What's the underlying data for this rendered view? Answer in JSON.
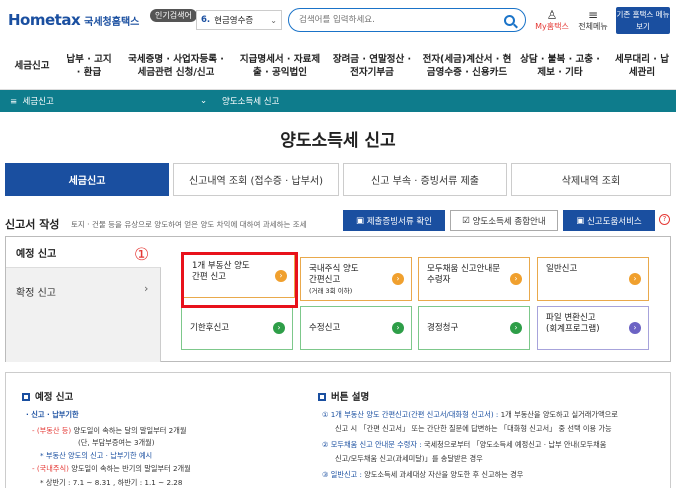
{
  "header": {
    "logo_text": "Hometax",
    "logo_sub": "국세청홈택스",
    "popular_badge": "인기검색어",
    "popular_num": "6.",
    "popular_term": "현금영수증",
    "search_placeholder": "검색어를 입력하세요.",
    "my_hometax": "My홈택스",
    "all_menu": "전체메뉴",
    "old_home": "기존 홈택스 메뉴 보기"
  },
  "gnb": [
    "세금신고",
    "납부 · 고지 · 환급",
    "국세증명 · 사업자등록 · 세금관련 신청/신고",
    "지급명세서 · 자료제출 · 공익법인",
    "장려금 · 연말정산 · 전자기부금",
    "전자(세금)계산서 · 현금영수증 · 신용카드",
    "상담 · 불복 · 고충 · 제보 · 기타",
    "세무대리 · 납세관리"
  ],
  "location": {
    "menu": "세금신고",
    "current": "양도소득세 신고"
  },
  "page_title": "양도소득세 신고",
  "tabs": [
    "세금신고",
    "신고내역 조회 (접수증 · 납부서)",
    "신고 부속 · 증빙서류 제출",
    "삭제내역 조회"
  ],
  "section": {
    "heading": "신고서 작성",
    "desc": "토지 · 건물 등을 유상으로 양도하여 얻은 양도 차익에 대하여 과세하는 조세",
    "btn_evidence": "제출증빙서류 확인",
    "btn_guide": "양도소득세 종합안내",
    "btn_help": "신고도움서비스",
    "help_mark": "?"
  },
  "side": {
    "scheduled": "예정 신고",
    "final": "확정 신고"
  },
  "annotation": "①",
  "cards": [
    {
      "l1": "1개 부동산 양도",
      "l2": "간편 신고",
      "small": ""
    },
    {
      "l1": "국내주식 양도",
      "l2": "간편신고",
      "small": "(거래 3회 이하)"
    },
    {
      "l1": "모두채움 신고안내문",
      "l2": "수령자",
      "small": ""
    },
    {
      "l1": "일반신고",
      "l2": "",
      "small": ""
    },
    {
      "l1": "기한후신고",
      "l2": "",
      "small": ""
    },
    {
      "l1": "수정신고",
      "l2": "",
      "small": ""
    },
    {
      "l1": "경정청구",
      "l2": "",
      "small": ""
    },
    {
      "l1": "파일 변환신고",
      "l2": "(회계프로그램)",
      "small": ""
    }
  ],
  "lower_left": {
    "heading": "예정 신고",
    "l1": "· 신고 · 납부기한",
    "l2a": "- (부동산 등)",
    "l2b": "양도일이 속하는 달의 말일부터 2개월",
    "l3": "(단, 부담부증여는 3개월)",
    "l4": "* 부동산 양도의 신고 · 납부기한 예시",
    "l5a": "- (국내주식)",
    "l5b": "양도일이 속하는 반기의 말일부터 2개월",
    "l6": "* 상반기 : 7.1 ~ 8.31 , 하반기 : 1.1 ~ 2.28"
  },
  "lower_right": {
    "heading": "버튼 설명",
    "r1a": "① 1개 부동산 양도 간편신고(간편 신고서/대화형 신고서) :",
    "r1b": " 1개 부동산을 양도하고 실거래가액으로",
    "r2": "신고 시 「간편 신고서」 또는 간단한 질문에 답변하는 「대화형 신고서」 중 선택 이용 가능",
    "r3a": "② 모두채움 신고 안내문 수령자 :",
    "r3b": " 국세청으로부터 「양도소득세 예정신고 · 납부 안내(모두채움",
    "r4": "신고/모두채움 신고(과세미달)」를 송달받은 경우",
    "r5a": "③ 일반신고 :",
    "r5b": " 양도소득세 과세대상 자산을 양도한 후 신고하는 경우"
  }
}
